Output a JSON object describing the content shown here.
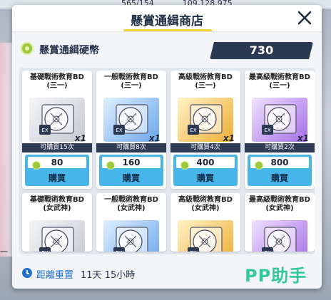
{
  "background": {
    "stats": [
      "565/154",
      "109,128,975"
    ],
    "left_text": "一"
  },
  "shop": {
    "title": "懸賞通緝商店",
    "currency": {
      "label": "懸賞通緝硬幣",
      "icon": "coin-icon",
      "value": "730"
    },
    "buy_label": "購買",
    "items": [
      {
        "name": "基礎戰術教育BD\n(三一)",
        "qty": "x1",
        "limit": "可購買15次",
        "price": "80",
        "tier": "gray",
        "icon": "disc-icon"
      },
      {
        "name": "一般戰術教育BD\n(三一)",
        "qty": "x1",
        "limit": "可購買8次",
        "price": "160",
        "tier": "blue",
        "icon": "disc-icon"
      },
      {
        "name": "高級戰術教育BD\n(三一)",
        "qty": "x1",
        "limit": "可購買4次",
        "price": "400",
        "tier": "gold",
        "icon": "disc-icon"
      },
      {
        "name": "最高級戰術教育BD\n(三一)",
        "qty": "x1",
        "limit": "可購買2次",
        "price": "800",
        "tier": "purple",
        "icon": "disc-icon"
      },
      {
        "name": "基礎戰術教育BD\n(女武神)",
        "tier": "gray",
        "icon": "disc-icon"
      },
      {
        "name": "一般戰術教育BD\n(女武神)",
        "tier": "blue",
        "icon": "disc-icon"
      },
      {
        "name": "高級戰術教育BD\n(女武神)",
        "tier": "gold",
        "icon": "disc-icon"
      },
      {
        "name": "最高級戰術教育BD\n(女武神)",
        "tier": "purple",
        "icon": "disc-icon"
      }
    ],
    "footer": {
      "reset_label": "距離重置",
      "reset_time": "11天 15小時",
      "icon": "clock-icon"
    },
    "watermark": "PP助手",
    "colors": {
      "accent": "#47b5e8",
      "title_underline": "#f2d23a",
      "dark_panel": "#2b3852",
      "coin": "#9cc83c",
      "watermark": "#35c99a"
    }
  }
}
